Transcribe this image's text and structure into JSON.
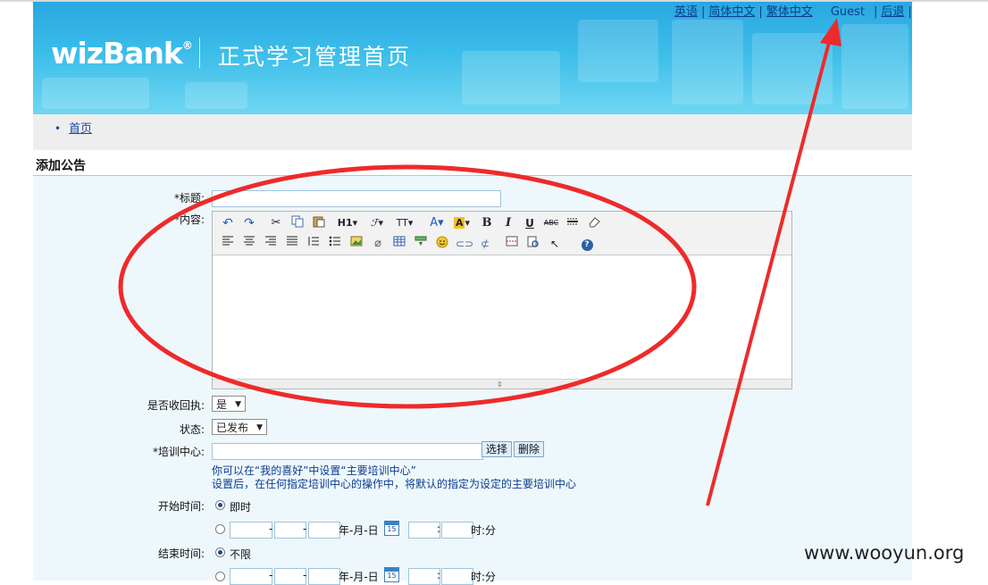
{
  "header": {
    "logo_text": "wizBank",
    "logo_mark": "®",
    "title": "正式学习管理首页",
    "links": {
      "english": "英语",
      "simplified_chinese": "简体中文",
      "traditional_chinese": "繁体中文",
      "user": "Guest",
      "logout": "后退",
      "sep": "|"
    }
  },
  "breadcrumb": {
    "bullet": "•",
    "home": "首页"
  },
  "section_title": "添加公告",
  "form": {
    "title_label": "*标题:",
    "title_value": "",
    "content_label": "*内容:",
    "receipt_label": "是否收回执:",
    "receipt_value": "是",
    "status_label": "状态:",
    "status_value": "已发布",
    "center_label": "*培训中心:",
    "center_value": "",
    "select_button": "选择",
    "delete_button": "删除",
    "hint_line1": "你可以在“我的喜好”中设置“主要培训中心”",
    "hint_line2": "设置后，在任何指定培训中心的操作中，将默认的指定为设定的主要培训中心",
    "start_label": "开始时间:",
    "start_immediate": "即时",
    "end_label": "结束时间:",
    "end_unlimited": "不限",
    "date_sep": "-",
    "date_suffix": "年-月-日",
    "time_sep": ":",
    "time_suffix": "时:分",
    "calendar_day": "15"
  },
  "editor_toolbar": {
    "row1": [
      "undo-icon",
      "redo-icon",
      "cut-icon",
      "copy-icon",
      "paste-icon",
      "heading-icon",
      "font-family-icon",
      "font-size-icon",
      "font-color-icon",
      "highlight-icon",
      "bold-icon",
      "italic-icon",
      "underline-icon",
      "strikethrough-icon",
      "horizontal-rule-icon",
      "eraser-icon"
    ],
    "row2": [
      "align-left-icon",
      "align-center-icon",
      "align-right-icon",
      "justify-icon",
      "ordered-list-icon",
      "unordered-list-icon",
      "image-icon",
      "attachment-icon",
      "table-icon",
      "insert-row-icon",
      "emoticon-icon",
      "link-icon",
      "unlink-icon",
      "page-break-icon",
      "preview-icon",
      "select-icon",
      "help-icon"
    ],
    "heading": "H1",
    "font_size": "TT",
    "bold": "B",
    "italic": "I",
    "underline": "U",
    "strike": "ABC",
    "help": "?"
  },
  "watermark": "www.wooyun.org",
  "colors": {
    "banner_top": "#2aa7e2",
    "banner_bottom": "#6fd7f2",
    "link": "#1a4b9a",
    "annotation_red": "#ee2a2a",
    "form_bg": "#eef7fb"
  }
}
